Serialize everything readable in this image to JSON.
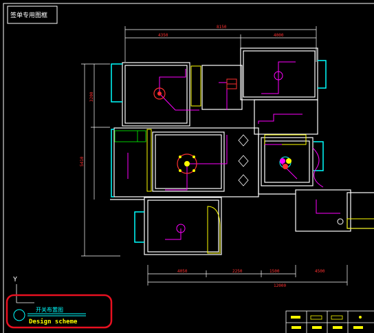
{
  "header_label": "签单专用图框",
  "axis_label": "Y",
  "title_block": {
    "chinese_title": "开关布置图",
    "english_title": "Design scheme"
  },
  "dimensions": {
    "top_total": "8150",
    "top_left": "4350",
    "top_right": "4000",
    "left_upper": "3200",
    "left_lower": "5410",
    "bottom_1": "4050",
    "bottom_2": "2250",
    "bottom_3": "1500",
    "bottom_4": "4500",
    "bottom_total": "12000"
  },
  "colors": {
    "background": "#000000",
    "wall": "#ffffff",
    "dimension": "#ff3030",
    "wiring": "#ff00ff",
    "fixture": "#ffff00",
    "window": "#00ffff",
    "highlight_circle": "#e81020",
    "title_text": "#00ffff"
  }
}
